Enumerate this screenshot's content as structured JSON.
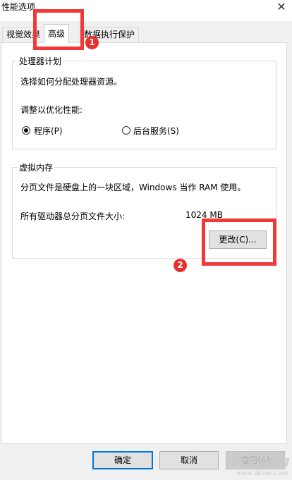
{
  "window": {
    "title": "性能选项",
    "close_glyph": "✕"
  },
  "tabs": [
    {
      "label": "视觉效果"
    },
    {
      "label": "高级"
    },
    {
      "label": "数据执行保护"
    }
  ],
  "processor_group": {
    "legend": "处理器计划",
    "description": "选择如何分配处理器资源。",
    "optimize_label": "调整以优化性能:",
    "options": [
      {
        "label": "程序(P)",
        "selected": true
      },
      {
        "label": "后台服务(S)",
        "selected": false
      }
    ]
  },
  "virtual_memory_group": {
    "legend": "虚拟内存",
    "description": "分页文件是硬盘上的一块区域，Windows 当作 RAM 使用。",
    "total_label": "所有驱动器总分页文件大小:",
    "total_value": "1024 MB",
    "change_button": "更改(C)..."
  },
  "footer": {
    "ok": "确定",
    "cancel": "取消",
    "apply": "应用(A)"
  },
  "annotations": {
    "marker_1": "1",
    "marker_2": "2",
    "highlight_color": "#f03a3a"
  },
  "watermark": {
    "main": "7T素源码网",
    "sub": "www.dkewl.com"
  }
}
